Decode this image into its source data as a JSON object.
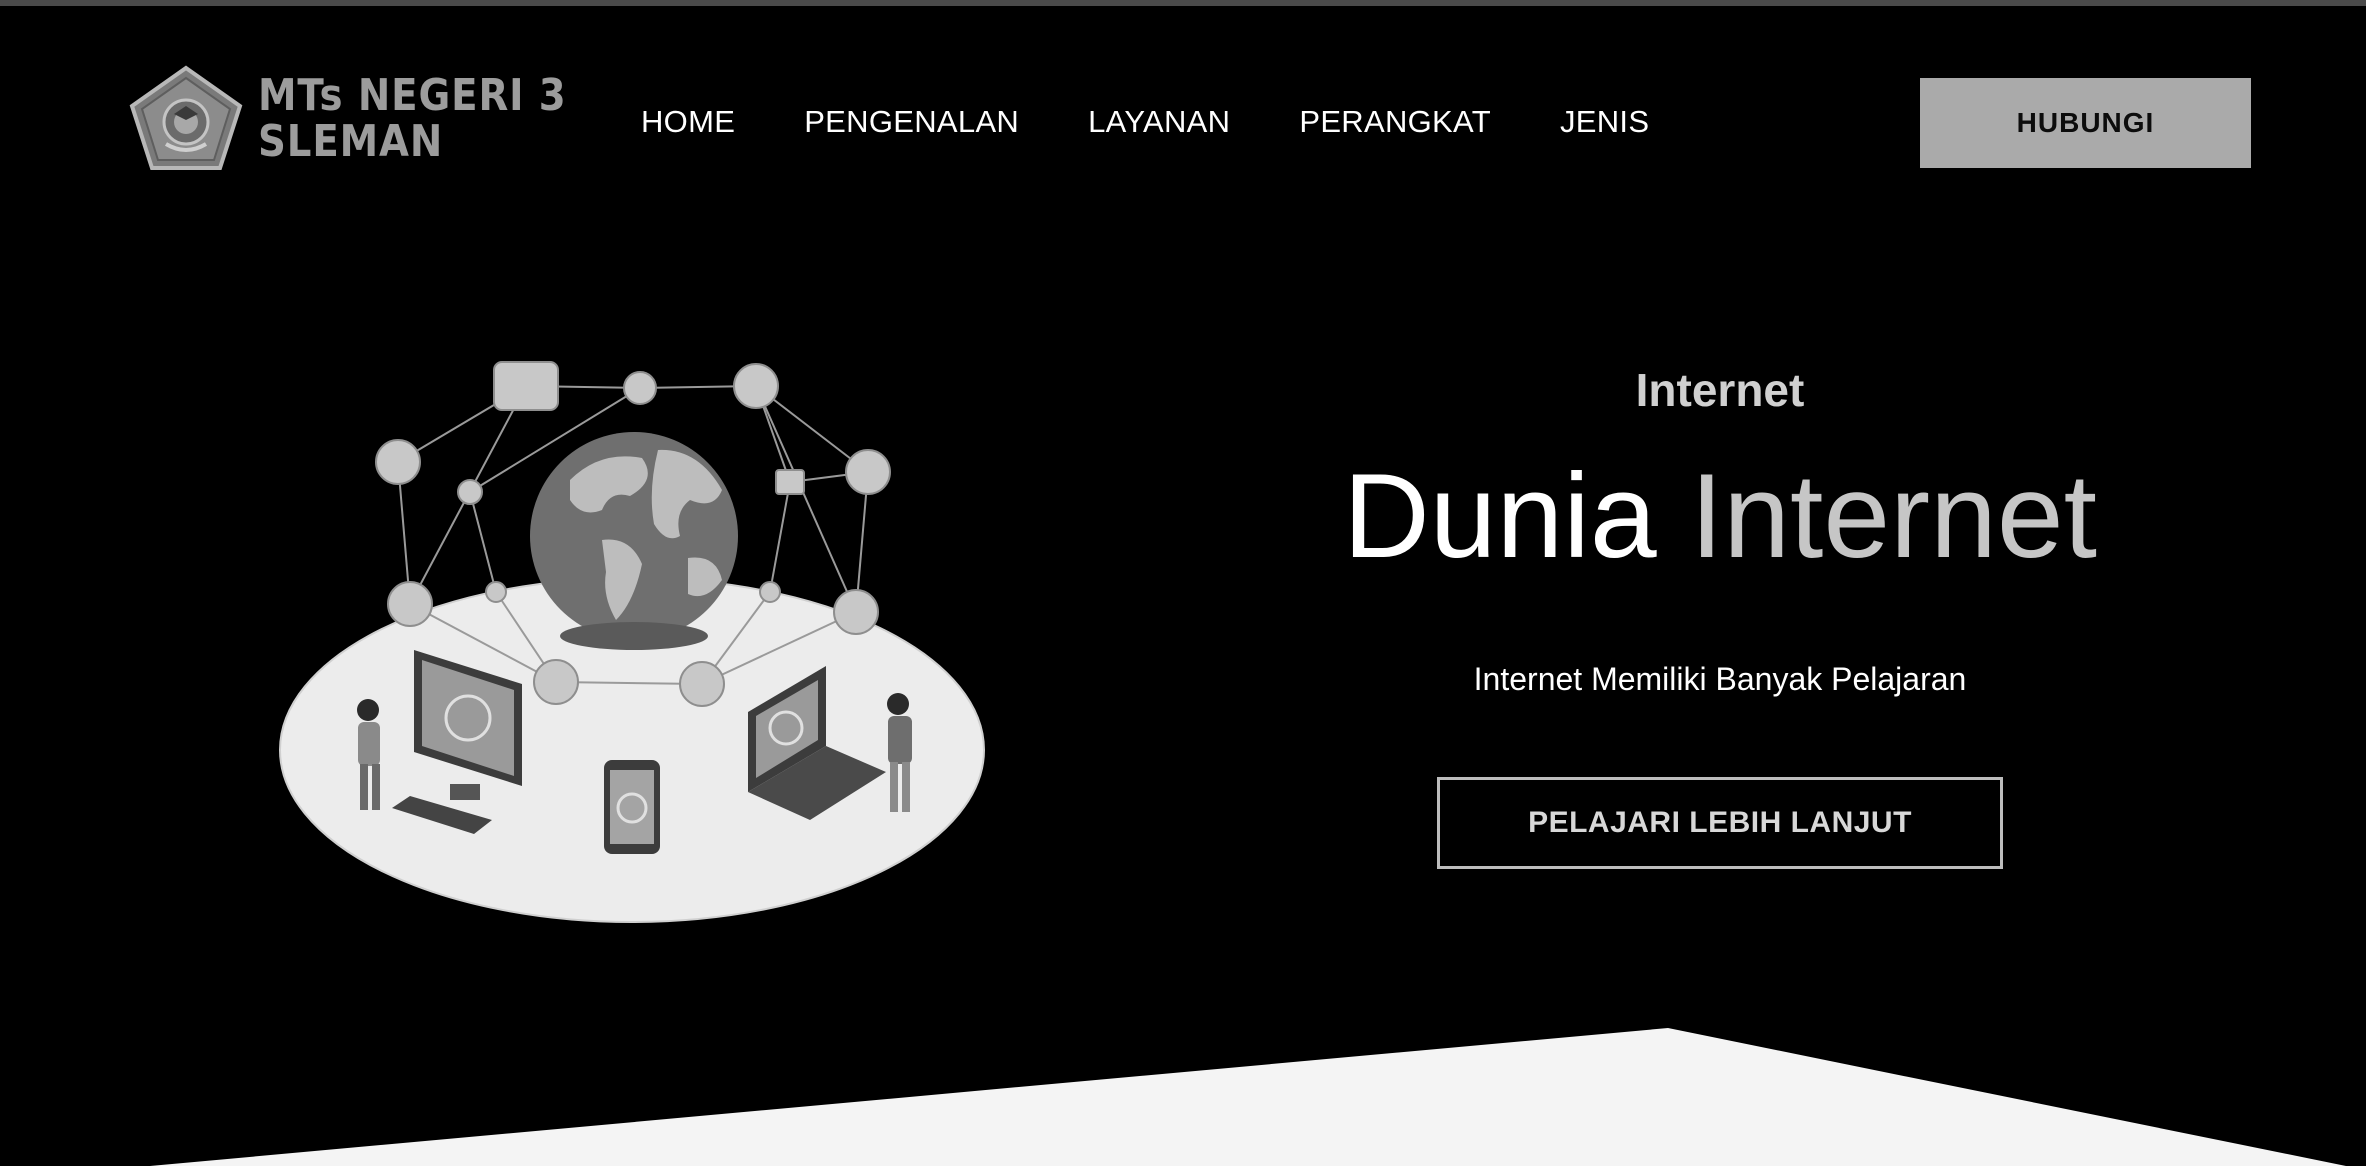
{
  "header": {
    "logo": {
      "line1": "MTs NEGERI 3",
      "line2": "SLEMAN"
    },
    "nav": [
      {
        "label": "HOME"
      },
      {
        "label": "PENGENALAN"
      },
      {
        "label": "LAYANAN"
      },
      {
        "label": "PERANGKAT"
      },
      {
        "label": "JENIS"
      }
    ],
    "contact_label": "HUBUNGI"
  },
  "hero": {
    "kicker": "Internet",
    "headline_main": "Dunia",
    "headline_accent": "Internet",
    "subtitle": "Internet Memiliki Banyak Pelajaran",
    "cta_label": "PELAJARI LEBIH LANJUT",
    "illustration": "globe-network-illustration"
  },
  "colors": {
    "background": "#000000",
    "logo_text": "#9c9c9c",
    "contact_button": "#aaaaaa",
    "headline_accent": "#c6c6c6",
    "bottom_section": "#f4f4f4"
  }
}
